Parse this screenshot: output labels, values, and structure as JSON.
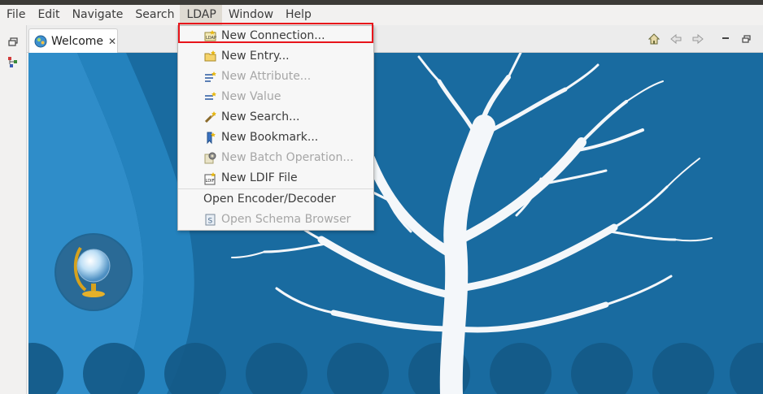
{
  "menubar": {
    "items": [
      "File",
      "Edit",
      "Navigate",
      "Search",
      "LDAP",
      "Window",
      "Help"
    ],
    "active": "LDAP"
  },
  "tab": {
    "label": "Welcome"
  },
  "ldap_menu": {
    "items": [
      {
        "label": "New Connection...",
        "icon": "new-connection-icon",
        "enabled": true
      },
      {
        "label": "New Entry...",
        "icon": "new-entry-icon",
        "enabled": true
      },
      {
        "label": "New Attribute...",
        "icon": "new-attribute-icon",
        "enabled": false
      },
      {
        "label": "New Value",
        "icon": "new-value-icon",
        "enabled": false
      },
      {
        "label": "New Search...",
        "icon": "new-search-icon",
        "enabled": true
      },
      {
        "label": "New Bookmark...",
        "icon": "new-bookmark-icon",
        "enabled": true
      },
      {
        "label": "New Batch Operation...",
        "icon": "new-batch-operation-icon",
        "enabled": false
      },
      {
        "label": "New LDIF File",
        "icon": "new-ldif-file-icon",
        "enabled": true
      },
      {
        "label": "Open Encoder/Decoder",
        "icon": "",
        "enabled": true
      },
      {
        "label": "Open Schema Browser",
        "icon": "schema-browser-icon",
        "enabled": false
      }
    ]
  },
  "colors": {
    "accent_highlight": "#e8151b",
    "welcome_background": "#1a6ea4",
    "menu_disabled_text": "#a6a6a6"
  }
}
